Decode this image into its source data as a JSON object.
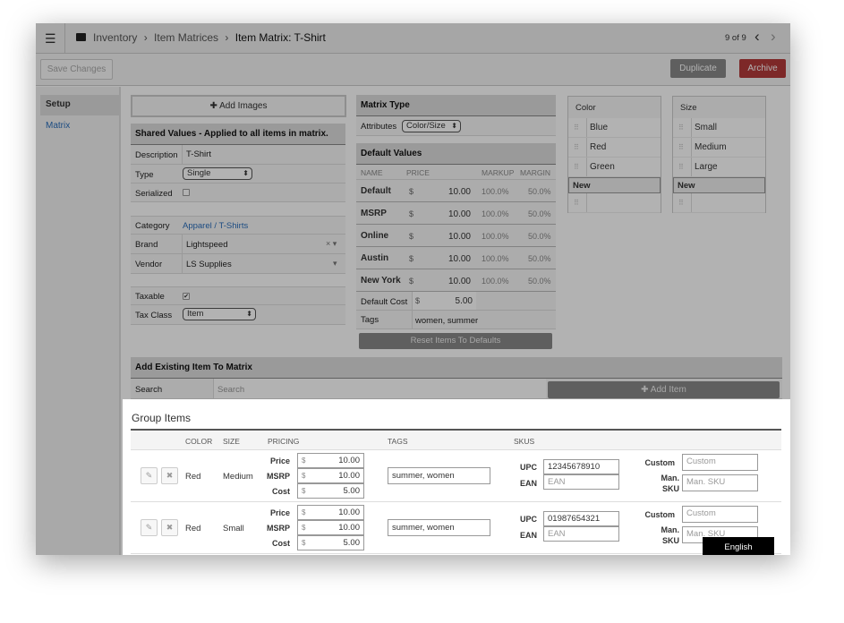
{
  "breadcrumb": [
    "Inventory",
    "Item Matrices",
    "Item Matrix: T-Shirt"
  ],
  "pager": "9 of 9",
  "toolbar": {
    "save": "Save Changes",
    "duplicate": "Duplicate",
    "archive": "Archive"
  },
  "colors": {
    "archive": "#a52a2a",
    "link": "#2a6ebb"
  },
  "sidebar": {
    "items": [
      {
        "label": "Setup"
      },
      {
        "label": "Matrix"
      }
    ]
  },
  "add_images": "Add Images",
  "shared": {
    "title": "Shared Values - Applied to all items in matrix.",
    "description_label": "Description",
    "description": "T-Shirt",
    "type_label": "Type",
    "type": "Single",
    "serialized_label": "Serialized",
    "category_label": "Category",
    "category": "Apparel / T-Shirts",
    "brand_label": "Brand",
    "brand": "Lightspeed",
    "vendor_label": "Vendor",
    "vendor": "LS Supplies",
    "taxable_label": "Taxable",
    "taxclass_label": "Tax Class",
    "taxclass": "Item"
  },
  "matrix_type": {
    "title": "Matrix Type",
    "attributes_label": "Attributes",
    "attributes": "Color/Size"
  },
  "defaults": {
    "title": "Default Values",
    "headers": [
      "NAME",
      "PRICE",
      "MARKUP",
      "MARGIN"
    ],
    "rows": [
      {
        "name": "Default",
        "price": "10.00",
        "markup": "100.0%",
        "margin": "50.0%"
      },
      {
        "name": "MSRP",
        "price": "10.00",
        "markup": "100.0%",
        "margin": "50.0%"
      },
      {
        "name": "Online",
        "price": "10.00",
        "markup": "100.0%",
        "margin": "50.0%"
      },
      {
        "name": "Austin",
        "price": "10.00",
        "markup": "100.0%",
        "margin": "50.0%"
      },
      {
        "name": "New York",
        "price": "10.00",
        "markup": "100.0%",
        "margin": "50.0%"
      }
    ],
    "currency": "$",
    "cost_label": "Default Cost",
    "cost": "5.00",
    "tags_label": "Tags",
    "tags": "women, summer",
    "reset": "Reset Items To Defaults"
  },
  "color_attr": {
    "title": "Color",
    "items": [
      "Blue",
      "Red",
      "Green"
    ],
    "new": "New"
  },
  "size_attr": {
    "title": "Size",
    "items": [
      "Small",
      "Medium",
      "Large"
    ],
    "new": "New"
  },
  "add_existing": {
    "title": "Add Existing Item To Matrix",
    "search_label": "Search",
    "search_placeholder": "Search",
    "add_item": "Add Item"
  },
  "group": {
    "title": "Group Items",
    "headers": [
      "COLOR",
      "SIZE",
      "PRICING",
      "TAGS",
      "SKUS"
    ],
    "labels": {
      "price": "Price",
      "msrp": "MSRP",
      "cost": "Cost",
      "upc": "UPC",
      "ean": "EAN",
      "custom": "Custom",
      "man1": "Man.",
      "man2": "SKU"
    },
    "placeholders": {
      "ean": "EAN",
      "custom": "Custom",
      "man": "Man. SKU"
    },
    "rows": [
      {
        "color": "Red",
        "size": "Medium",
        "price": "10.00",
        "msrp": "10.00",
        "cost": "5.00",
        "tags": "summer, women",
        "upc": "12345678910"
      },
      {
        "color": "Red",
        "size": "Small",
        "price": "10.00",
        "msrp": "10.00",
        "cost": "5.00",
        "tags": "summer, women",
        "upc": "01987654321"
      }
    ]
  },
  "language": "English"
}
